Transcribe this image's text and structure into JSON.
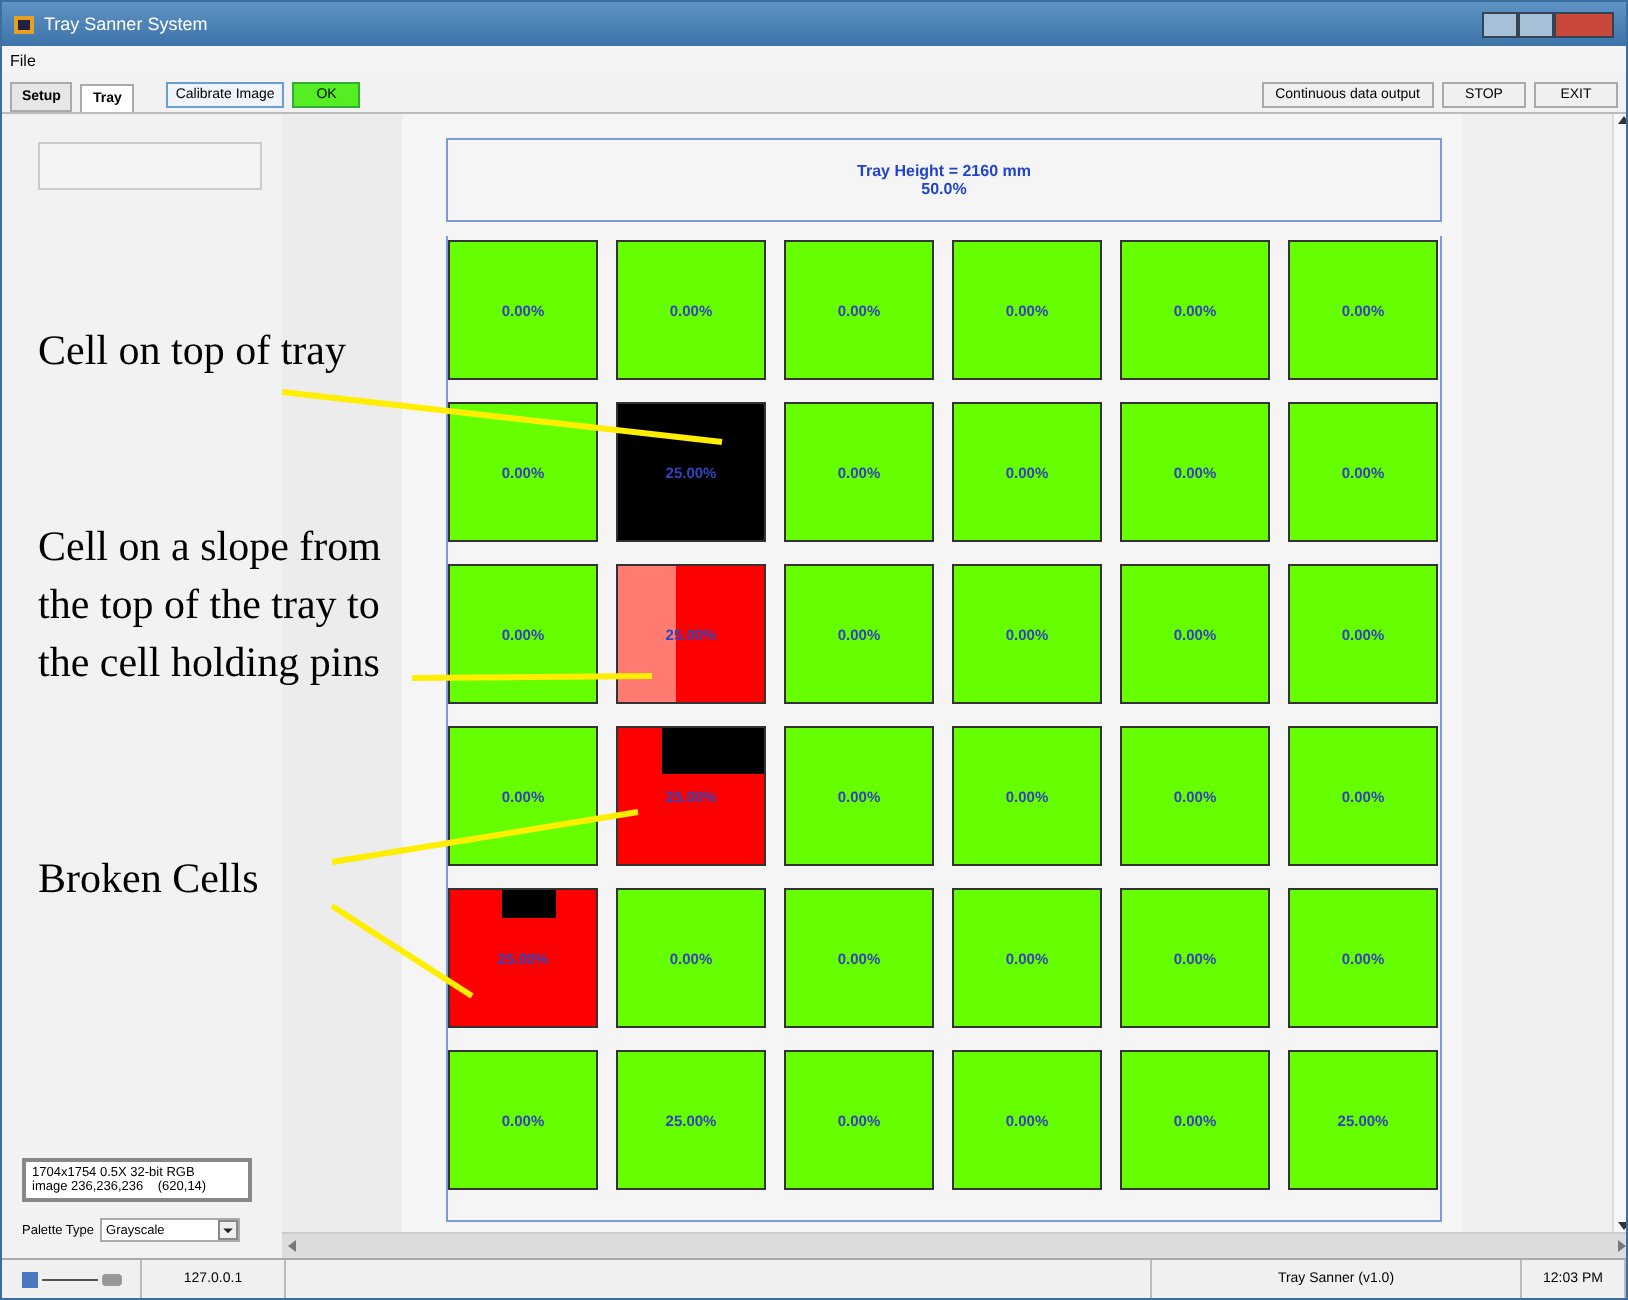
{
  "window": {
    "title": "Tray Sanner System"
  },
  "menu": [
    "File"
  ],
  "tabs": [
    {
      "label": "Setup",
      "selected": false
    },
    {
      "label": "Tray",
      "selected": true
    }
  ],
  "toolbar_left": [
    {
      "label": "Calibrate Image",
      "kind": "outline"
    },
    {
      "label": "OK",
      "kind": "green"
    }
  ],
  "toolbar_right": [
    "Continuous data output",
    "STOP",
    "EXIT"
  ],
  "tray": {
    "height": "Tray Height = 2160 mm",
    "percent": "50.0%"
  },
  "rows": [
    [
      {
        "kind": "ok",
        "value": "0.00%"
      },
      {
        "kind": "ok",
        "value": "0.00%"
      },
      {
        "kind": "ok",
        "value": "0.00%"
      },
      {
        "kind": "ok",
        "value": "0.00%"
      },
      {
        "kind": "ok",
        "value": "0.00%"
      },
      {
        "kind": "ok",
        "value": "0.00%"
      }
    ],
    [
      {
        "kind": "ok",
        "value": "0.00%"
      },
      {
        "kind": "top",
        "value": "25.00%"
      },
      {
        "kind": "ok",
        "value": "0.00%"
      },
      {
        "kind": "ok",
        "value": "0.00%"
      },
      {
        "kind": "ok",
        "value": "0.00%"
      },
      {
        "kind": "ok",
        "value": "0.00%"
      }
    ],
    [
      {
        "kind": "ok",
        "value": "0.00%"
      },
      {
        "kind": "slope",
        "value": "25.00%"
      },
      {
        "kind": "ok",
        "value": "0.00%"
      },
      {
        "kind": "ok",
        "value": "0.00%"
      },
      {
        "kind": "ok",
        "value": "0.00%"
      },
      {
        "kind": "ok",
        "value": "0.00%"
      }
    ],
    [
      {
        "kind": "ok",
        "value": "0.00%"
      },
      {
        "kind": "broken-wide",
        "value": "25.00%"
      },
      {
        "kind": "ok",
        "value": "0.00%"
      },
      {
        "kind": "ok",
        "value": "0.00%"
      },
      {
        "kind": "ok",
        "value": "0.00%"
      },
      {
        "kind": "ok",
        "value": "0.00%"
      }
    ],
    [
      {
        "kind": "broken-small",
        "value": "25.00%"
      },
      {
        "kind": "ok",
        "value": "0.00%"
      },
      {
        "kind": "ok",
        "value": "0.00%"
      },
      {
        "kind": "ok",
        "value": "0.00%"
      },
      {
        "kind": "ok",
        "value": "0.00%"
      },
      {
        "kind": "ok",
        "value": "0.00%"
      }
    ],
    [
      {
        "kind": "ok",
        "value": "0.00%"
      },
      {
        "kind": "ok",
        "value": "25.00%"
      },
      {
        "kind": "ok",
        "value": "0.00%"
      },
      {
        "kind": "ok",
        "value": "0.00%"
      },
      {
        "kind": "ok",
        "value": "0.00%"
      },
      {
        "kind": "ok",
        "value": "25.00%"
      }
    ]
  ],
  "image_info": [
    "1704x1754 0.5X 32-bit RGB",
    "image 236,236,236    (620,14)"
  ],
  "palette": {
    "label": "Palette Type",
    "value": "Grayscale"
  },
  "annotations": [
    "Cell on top of tray",
    "Cell on a slope from the top of the tray to the cell holding pins",
    "Broken Cells"
  ],
  "status_bar": {
    "address": "127.0.0.1",
    "app": "Tray Sanner (v1.0)",
    "time": "12:03 PM"
  }
}
